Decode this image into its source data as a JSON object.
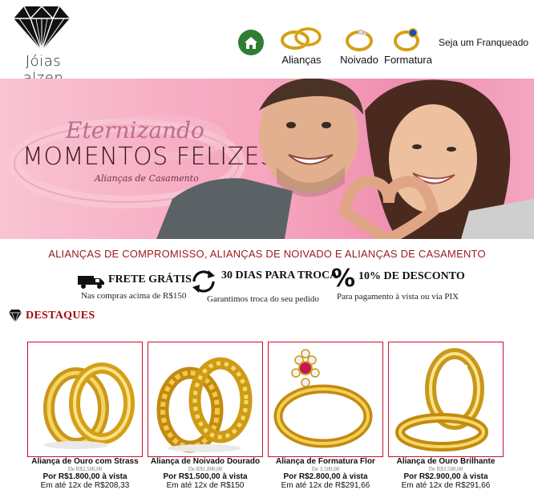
{
  "header": {
    "logo_text": "Jóias alzen",
    "nav": [
      {
        "label": "Alianças",
        "icon": "wedding-rings-icon"
      },
      {
        "label": "Noivado",
        "icon": "engagement-ring-icon"
      },
      {
        "label": "Formatura",
        "icon": "graduation-ring-icon"
      }
    ],
    "franchise_label": "Seja um Franqueado",
    "home_icon": "home-icon"
  },
  "banner": {
    "script": "Eternizando",
    "title": "MOMENTOS FELIZES",
    "subtitle": "Alianças de Casamento"
  },
  "tagline": "ALIANÇAS DE COMPROMISSO, ALIANÇAS DE NOIVADO E ALIANÇAS DE CASAMENTO",
  "benefits": [
    {
      "title": "FRETE GRÁTIS",
      "subtitle": "Nas compras acima de R$150",
      "icon": "truck-icon"
    },
    {
      "title": "30 DIAS PARA TROCA",
      "subtitle": "Garantimos troca do seu pedido",
      "icon": "exchange-arrows-icon"
    },
    {
      "title": "10% DE DESCONTO",
      "subtitle": "Para pagamento à vista ou via PIX",
      "icon": "percent-icon"
    }
  ],
  "section_title": "DESTAQUES",
  "products": [
    {
      "name": "Aliança de Ouro com Strass",
      "old_price": "De R$2.500,00",
      "price": "Por R$1.800,00 à vista",
      "installments": "Em até 12x de R$208,33"
    },
    {
      "name": "Aliança de Noivado Dourado",
      "old_price": "De R$1.800,00",
      "price": "Por R$1.500,00 à vista",
      "installments": "Em até 12x de R$150"
    },
    {
      "name": "Aliança de Formatura Flor",
      "old_price": "De 3.500,00",
      "price": "Por R$2.800,00 à vista",
      "installments": "Em até 12x de R$291,66"
    },
    {
      "name": "Aliança de Ouro Brilhante",
      "old_price": "De R$3.500,00",
      "price": "Por R$2.900,00 à vista",
      "installments": "Em até 12x de R$291,66"
    }
  ],
  "colors": {
    "accent_red": "#a00c0c",
    "card_border": "#c8102e",
    "home_green": "#2e7d32",
    "banner_pink": "#f5a2bc",
    "gold": "#d4a017"
  }
}
